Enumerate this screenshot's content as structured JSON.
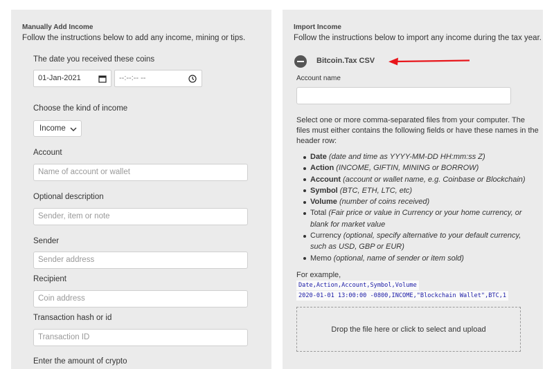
{
  "manual": {
    "title": "Manually Add Income",
    "subtitle": "Follow the instructions below to add any income, mining or tips.",
    "date_label": "The date you received these coins",
    "date_value": "01-Jan-2021",
    "time_value": "--:--:-- --",
    "kind_label": "Choose the kind of income",
    "kind_value": "Income",
    "account_label": "Account",
    "account_placeholder": "Name of account or wallet",
    "description_label": "Optional description",
    "description_placeholder": "Sender, item or note",
    "sender_label": "Sender",
    "sender_placeholder": "Sender address",
    "recipient_label": "Recipient",
    "recipient_placeholder": "Coin address",
    "txhash_label": "Transaction hash or id",
    "txhash_placeholder": "Transaction ID",
    "amount_label": "Enter the amount of crypto"
  },
  "import": {
    "title": "Import Income",
    "subtitle": "Follow the instructions below to import any income during the tax year.",
    "csv_title": "Bitcoin.Tax CSV",
    "account_name_label": "Account name",
    "account_name_value": "",
    "instructions": "Select one or more comma-separated files from your computer. The files must either contains the following fields or have these names in the header row:",
    "fields": [
      {
        "name": "Date",
        "desc": "(date and time as YYYY-MM-DD HH:mm:ss Z)"
      },
      {
        "name": "Action",
        "desc": "(INCOME, GIFTIN, MINING or BORROW)"
      },
      {
        "name": "Account",
        "desc": "(account or wallet name, e.g. Coinbase or Blockchain)"
      },
      {
        "name": "Symbol",
        "desc": "(BTC, ETH, LTC, etc)"
      },
      {
        "name": "Volume",
        "desc": "(number of coins received)"
      },
      {
        "name": "Total",
        "desc": "(Fair price or value in Currency or your home currency, or blank for market value"
      },
      {
        "name": "Currency",
        "desc": "(optional, specify alternative to your default currency, such as USD, GBP or EUR)"
      },
      {
        "name": "Memo",
        "desc": "(optional, name of sender or item sold)"
      }
    ],
    "example_label": "For example,",
    "example_header": "Date,Action,Account,Symbol,Volume",
    "example_row": "2020-01-01 13:00:00 -0800,INCOME,\"Blockchain Wallet\",BTC,1",
    "dropzone_text": "Drop the file here or click to select and upload"
  },
  "colors": {
    "panel_bg": "#ebebeb",
    "arrow": "#e8161b",
    "code_text": "#1a1aa6"
  }
}
